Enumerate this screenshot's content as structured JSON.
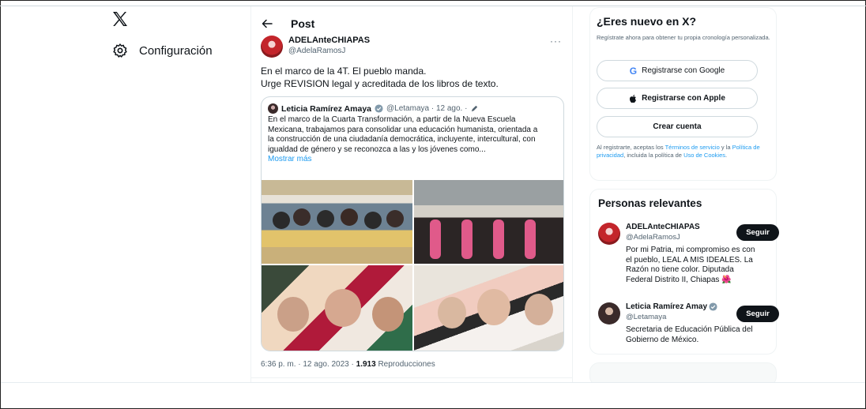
{
  "nav": {
    "logo_icon": "x-logo-icon",
    "settings_label": "Configuración",
    "settings_icon": "gear-icon"
  },
  "header": {
    "title": "Post"
  },
  "post": {
    "author_name": "ADELAnteCHIAPAS",
    "author_handle": "@AdelaRamosJ",
    "text_line1": "En el marco de la 4T. El pueblo manda.",
    "text_line2": "Urge REVISION legal y acreditada de los libros de texto.",
    "quote": {
      "author_name": "Leticia Ramírez Amaya",
      "meta": "@Letamaya · 12 ago. ·",
      "lines": [
        "En el marco de la Cuarta Transformación, a partir de la Nueva Escuela",
        "Mexicana, trabajamos para consolidar una educación humanista, orientada a",
        "la construcción de una ciudadanía democrática, incluyente, intercultural, con",
        "igualdad de género y se reconozca a las y los jóvenes como..."
      ],
      "show_more": "Mostrar más"
    },
    "timestamp": "6:36 p. m. · 12 ago. 2023 ·",
    "views_count": "1.913",
    "views_label": "Reproducciones"
  },
  "signup": {
    "title": "¿Eres nuevo en X?",
    "subtitle": "Regístrate ahora para obtener tu propia cronología personalizada.",
    "google_label": "Registrarse con Google",
    "apple_label": "Registrarse con Apple",
    "create_label": "Crear cuenta",
    "legal_prefix": "Al registrarte, aceptas los ",
    "terms_link": "Términos de servicio",
    "legal_and": " y la ",
    "privacy_link": "Política de privacidad",
    "legal_mid": ", incluida la política de ",
    "cookies_link": "Uso de Cookies",
    "legal_end": "."
  },
  "people": {
    "title": "Personas relevantes",
    "items": [
      {
        "name": "ADELAnteCHIAPAS",
        "handle": "@AdelaRamosJ",
        "bio_lines": [
          "Por mi Patria, mi compromiso es con",
          "el pueblo, LEAL A MIS IDEALES. La",
          "Razón no tiene color. Diputada",
          "Federal Distrito II, Chiapas 🌺"
        ],
        "follow_label": "Seguir"
      },
      {
        "name": "Leticia Ramírez Amay",
        "handle": "@Letamaya",
        "bio_lines": [
          "Secretaria de Educación Pública del",
          "Gobierno de México."
        ],
        "follow_label": "Seguir"
      }
    ]
  },
  "colors": {
    "accent": "#1d9bf0",
    "text": "#0f1419",
    "muted": "#536471",
    "follow_bg": "#0f1419"
  }
}
